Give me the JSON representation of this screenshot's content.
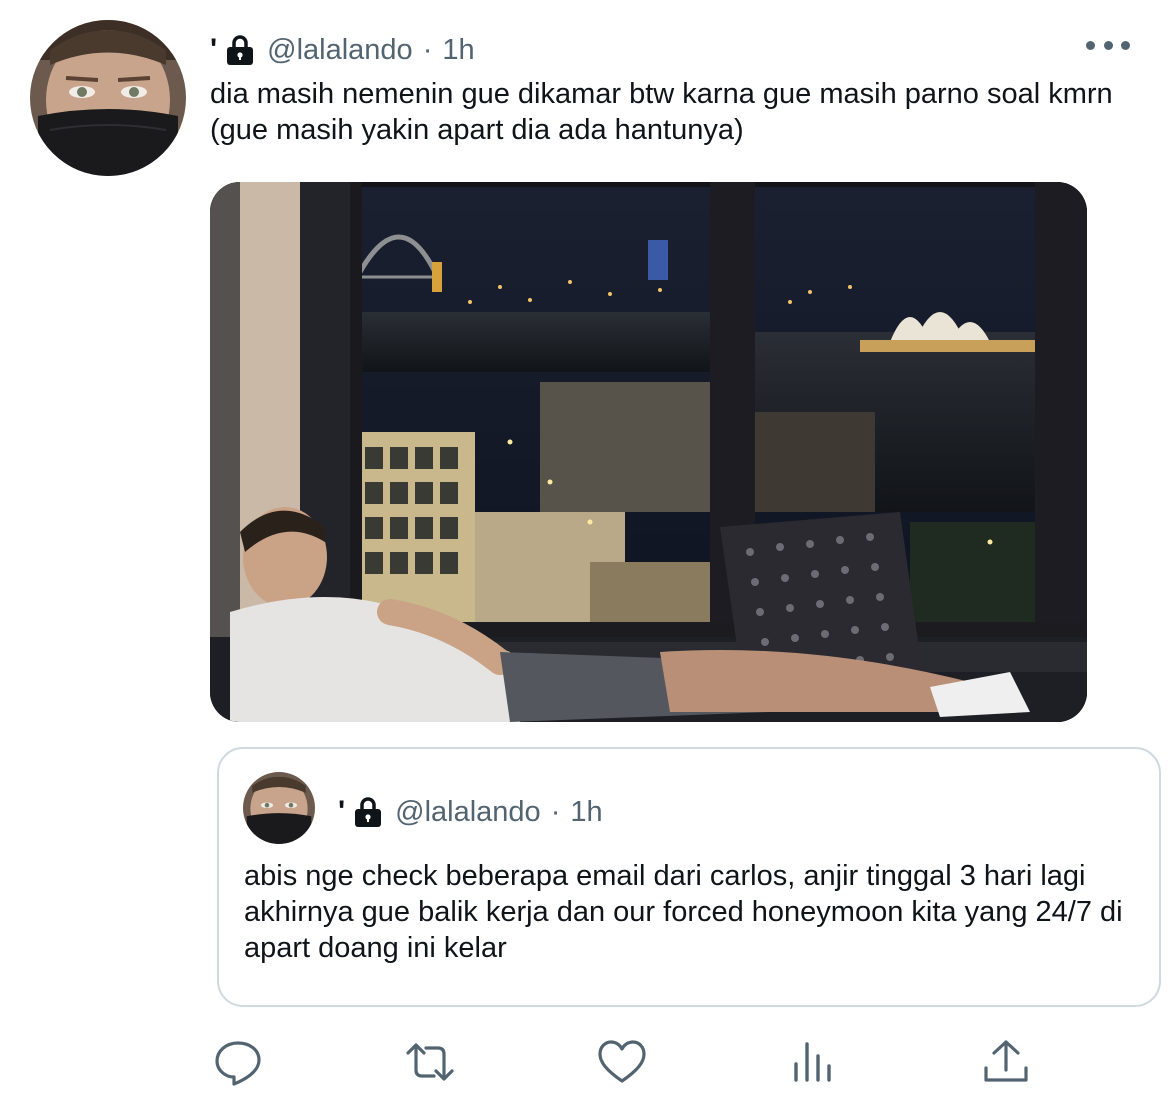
{
  "tweet": {
    "name_mark": "'",
    "handle": "@lalalando",
    "separator": "·",
    "time": "1h",
    "text": "dia masih nemenin gue dikamar btw karna gue masih parno soal kmrn (gue masih yakin apart dia ada hantunya)"
  },
  "quoted_tweet": {
    "name_mark": "'",
    "handle": "@lalalando",
    "separator": "·",
    "time": "1h",
    "text": "abis nge check beberapa email dari carlos, anjir tinggal 3 hari lagi akhirnya gue balik kerja dan our forced honeymoon kita yang 24/7 di apart doang ini kelar"
  },
  "icons": {
    "more": "more-horizontal-icon",
    "lock": "lock-icon",
    "reply": "reply-icon",
    "retweet": "retweet-icon",
    "like": "heart-icon",
    "views": "analytics-icon",
    "share": "share-icon"
  },
  "colors": {
    "text": "#0f1419",
    "secondary": "#536471",
    "border": "#cfd9de"
  }
}
